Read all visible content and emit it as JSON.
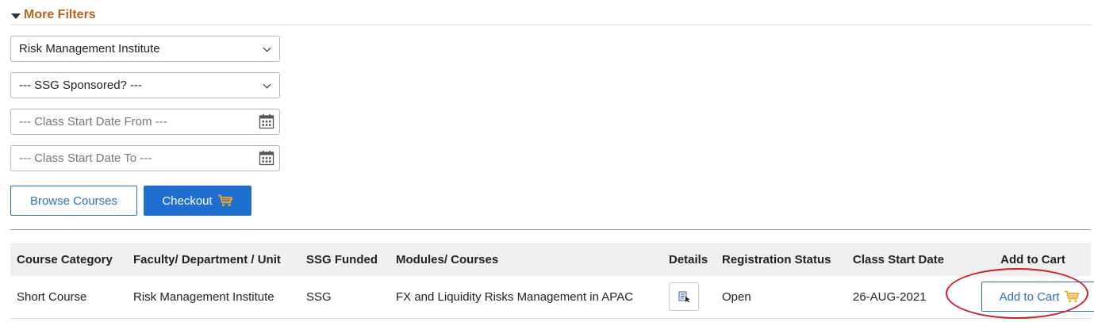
{
  "filters": {
    "header": "More Filters",
    "institute_select": {
      "value": "Risk Management Institute",
      "options": [
        "Risk Management Institute"
      ]
    },
    "ssg_select": {
      "value": "--- SSG Sponsored? ---",
      "options": [
        "--- SSG Sponsored? ---"
      ]
    },
    "start_from": {
      "placeholder": "--- Class Start Date From ---"
    },
    "start_to": {
      "placeholder": "--- Class Start Date To ---"
    }
  },
  "actions": {
    "browse_label": "Browse Courses",
    "checkout_label": "Checkout"
  },
  "table": {
    "headers": [
      "Course Category",
      "Faculty/ Department / Unit",
      "SSG Funded",
      "Modules/ Courses",
      "Details",
      "Registration Status",
      "Class Start Date",
      "Add to Cart"
    ],
    "rows": [
      {
        "category": "Short Course",
        "faculty": "Risk Management Institute",
        "ssg": "SSG",
        "module": "FX and Liquidity Risks Management in APAC",
        "status": "Open",
        "start_date": "26-AUG-2021",
        "cart_label": "Add to Cart"
      }
    ]
  },
  "icons": {
    "caret": "caret-down-icon",
    "calendar": "calendar-icon",
    "cart": "shopping-cart-icon",
    "details": "details-list-icon"
  },
  "colors": {
    "header_orange": "#b8651c",
    "primary_blue": "#1f6fd0",
    "cart_orange": "#f5a623",
    "annotation_red": "#d41e1e"
  }
}
